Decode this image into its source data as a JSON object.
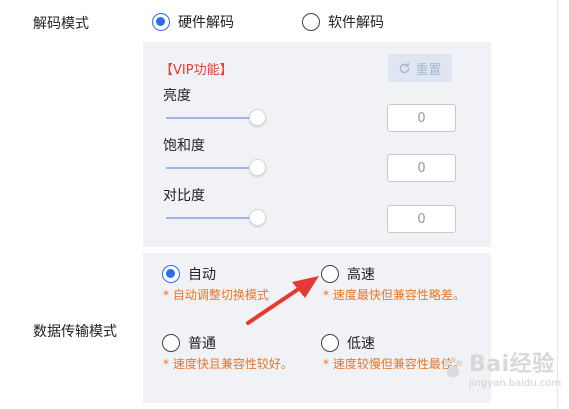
{
  "decode": {
    "label": "解码模式",
    "options": [
      {
        "label": "硬件解码",
        "selected": true
      },
      {
        "label": "软件解码",
        "selected": false
      }
    ]
  },
  "vip": {
    "title": "【VIP功能】",
    "reset_label": "重置",
    "sliders": [
      {
        "label": "亮度",
        "value": "0"
      },
      {
        "label": "饱和度",
        "value": "0"
      },
      {
        "label": "对比度",
        "value": "0"
      }
    ]
  },
  "transfer": {
    "label": "数据传输模式",
    "options": [
      {
        "label": "自动",
        "selected": true,
        "hint": "* 自动调整切换模式"
      },
      {
        "label": "高速",
        "selected": false,
        "hint": "* 速度最快但兼容性略差。"
      },
      {
        "label": "普通",
        "selected": false,
        "hint": "* 速度快且兼容性较好。"
      },
      {
        "label": "低速",
        "selected": false,
        "hint": "* 速度较慢但兼容性最佳。"
      }
    ]
  },
  "colors": {
    "accent": "#2d6cf0",
    "vip_red": "#e63b2e",
    "hint_orange": "#e8762a",
    "annotation_arrow": "#e53935"
  },
  "watermark": {
    "text": "Bai经验",
    "sub": "jingyan.baidu.com"
  }
}
